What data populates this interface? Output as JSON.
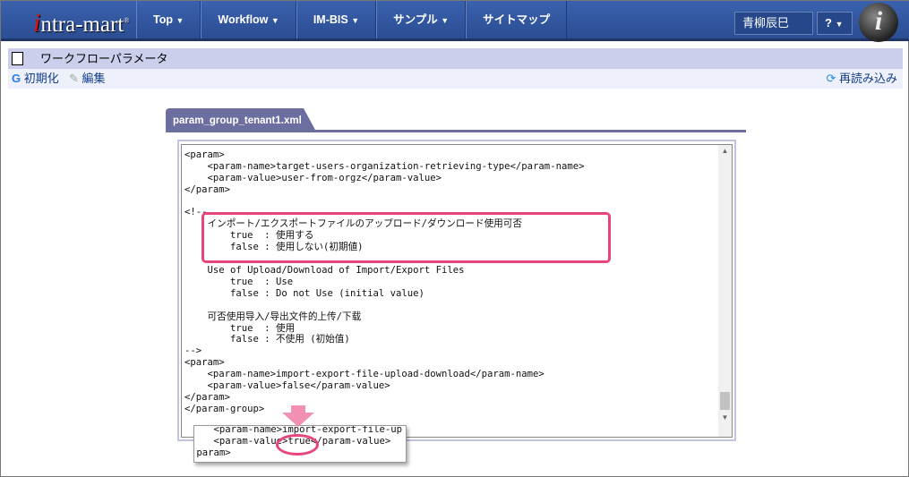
{
  "header": {
    "logo": "intra-mart",
    "nav": [
      {
        "label": "Top",
        "dropdown": true
      },
      {
        "label": "Workflow",
        "dropdown": true
      },
      {
        "label": "IM-BIS",
        "dropdown": true
      },
      {
        "label": "サンプル",
        "dropdown": true
      },
      {
        "label": "サイトマップ",
        "dropdown": false
      }
    ],
    "user": "青柳辰巳",
    "help": "?"
  },
  "page": {
    "title": "ワークフローパラメータ",
    "toolbar": {
      "init": "初期化",
      "edit": "編集",
      "reload": "再読み込み"
    }
  },
  "tab": {
    "label": "param_group_tenant1.xml"
  },
  "editor": {
    "content": "    -->\n<param>\n    <param-name>target-users-organization-retrieving-type</param-name>\n    <param-value>user-from-orgz</param-value>\n</param>\n\n<!--\n    インポート/エクスポートファイルのアップロード/ダウンロード使用可否\n        true  : 使用する\n        false : 使用しない(初期値)\n\n    Use of Upload/Download of Import/Export Files\n        true  : Use\n        false : Do not Use (initial value)\n\n    可否使用导入/导出文件的上传/下载\n        true  : 使用\n        false : 不使用 (初始值)\n-->\n<param>\n    <param-name>import-export-file-upload-download</param-name>\n    <param-value>false</param-value>\n</param>\n</param-group>"
  },
  "popup": {
    "content": "    <param-name>import-export-file-up\n    <param-value>true</param-value>\n param>"
  },
  "colors": {
    "accent": "#e8457d",
    "header": "#2b4d93",
    "tab": "#6b6e9f"
  }
}
